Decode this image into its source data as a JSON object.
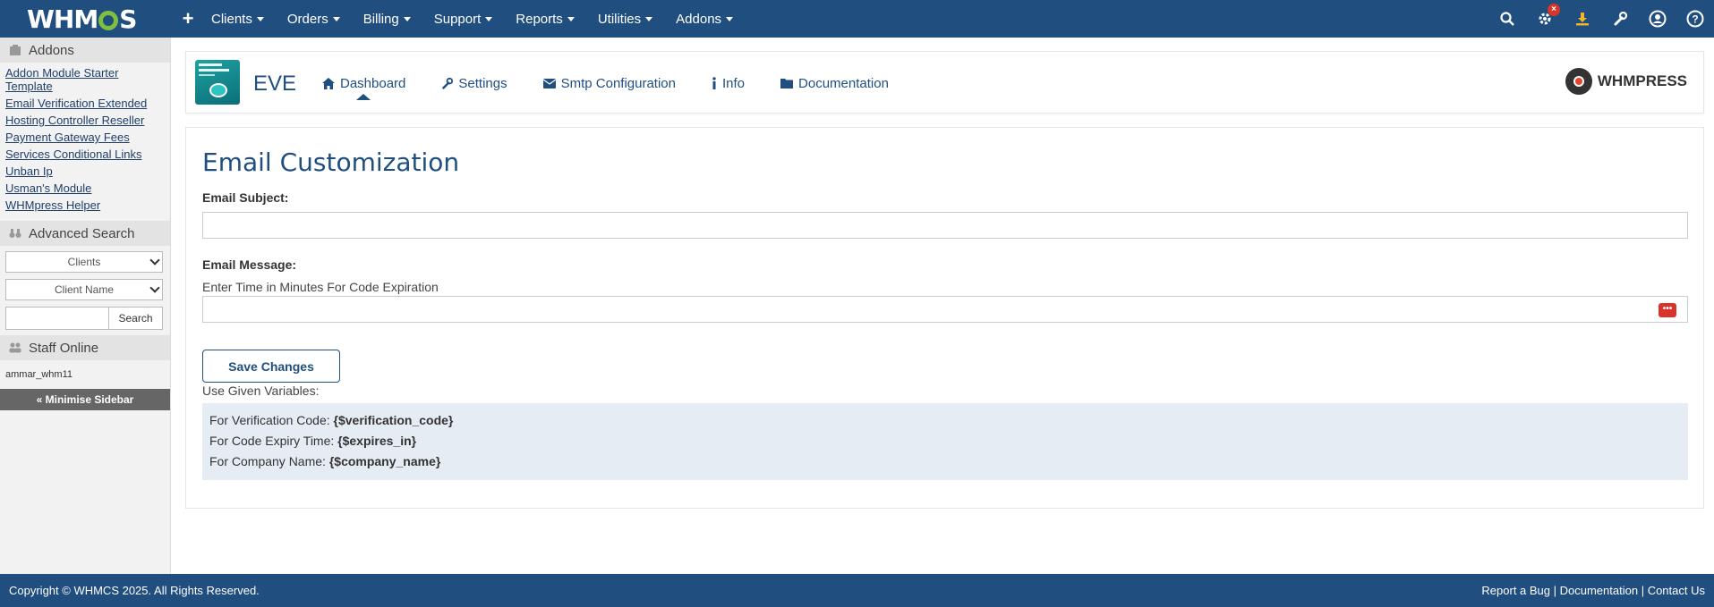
{
  "topnav": {
    "logo": "WHMCS",
    "items": [
      {
        "label": "Clients"
      },
      {
        "label": "Orders"
      },
      {
        "label": "Billing"
      },
      {
        "label": "Support"
      },
      {
        "label": "Reports"
      },
      {
        "label": "Utilities"
      },
      {
        "label": "Addons"
      }
    ],
    "right_icons": [
      "search-icon",
      "gear-alert-icon",
      "download-icon",
      "wrench-icon",
      "user-circle-icon",
      "help-icon"
    ],
    "brand_color": "#1f4e7f",
    "logo_accent": "#7fbf3f"
  },
  "sidebar": {
    "addons_title": "Addons",
    "addons": [
      "Addon Module Starter Template",
      "Email Verification Extended",
      "Hosting Controller Reseller",
      "Payment Gateway Fees",
      "Services Conditional Links",
      "Unban Ip",
      "Usman's Module",
      "WHMpress Helper"
    ],
    "advanced_search_title": "Advanced Search",
    "search_type": "Clients",
    "search_field": "Client Name",
    "search_button": "Search",
    "staff_title": "Staff Online",
    "staff_user": "ammar_whm11",
    "minimise": "« Minimise Sidebar"
  },
  "module": {
    "name": "EVE",
    "tabs": [
      {
        "label": "Dashboard",
        "icon": "home-icon"
      },
      {
        "label": "Settings",
        "icon": "wrench-icon"
      },
      {
        "label": "Smtp Configuration",
        "icon": "envelope-icon"
      },
      {
        "label": "Info",
        "icon": "info-icon"
      },
      {
        "label": "Documentation",
        "icon": "folder-icon"
      }
    ],
    "brand": "WHMPRESS"
  },
  "main": {
    "title": "Email Customization",
    "subject_label": "Email Subject:",
    "subject_value": "",
    "message_label": "Email Message:",
    "message_hint": "Enter Time in Minutes For Code Expiration",
    "message_value": "",
    "save_button": "Save Changes",
    "variables_label": "Use Given Variables:",
    "variables": [
      {
        "label": "For Verification Code: ",
        "var": "{$verification_code}"
      },
      {
        "label": "For Code Expiry Time: ",
        "var": "{$expires_in}"
      },
      {
        "label": "For Company Name: ",
        "var": "{$company_name}"
      }
    ]
  },
  "footer": {
    "copyright": "Copyright © WHMCS 2025. All Rights Reserved.",
    "links": [
      "Report a Bug",
      "Documentation",
      "Contact Us"
    ]
  }
}
